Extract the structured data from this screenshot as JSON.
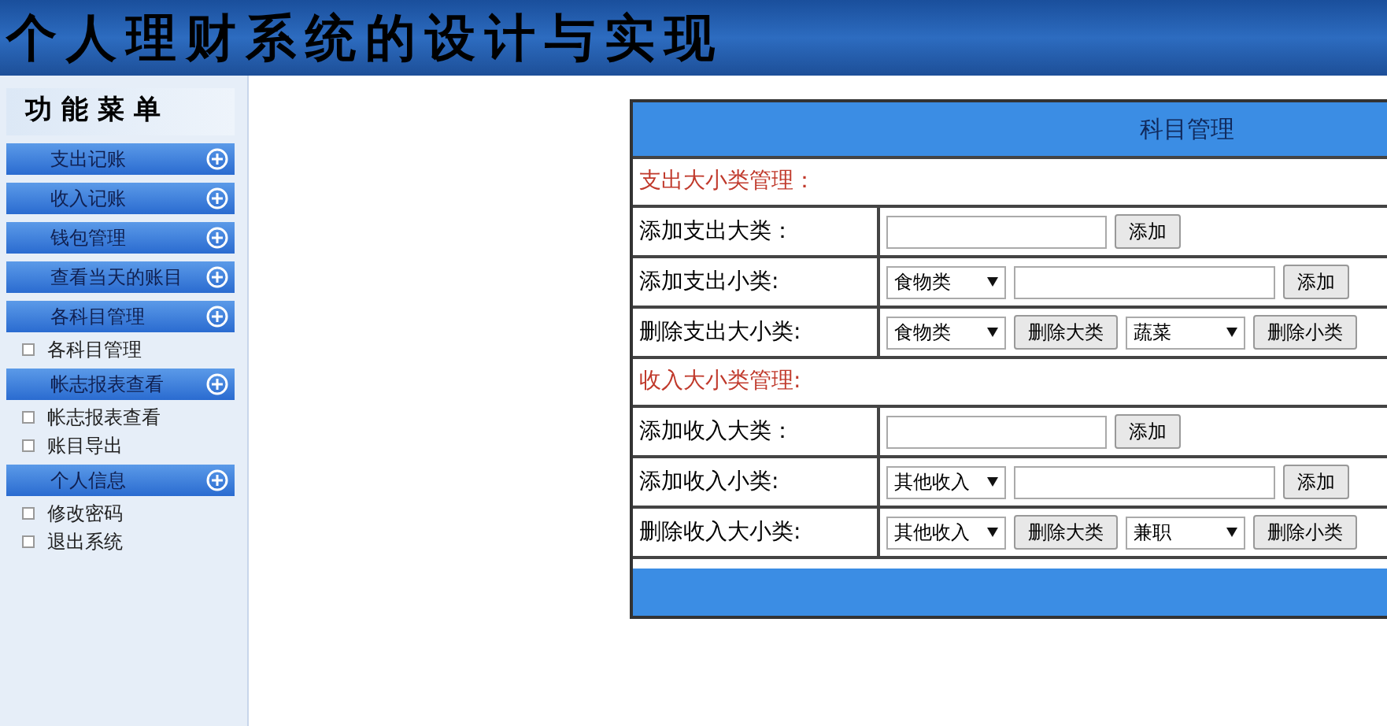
{
  "banner": {
    "title": "个人理财系统的设计与实现"
  },
  "sidebar": {
    "title": "功能菜单",
    "items": [
      {
        "kind": "group",
        "label": "支出记账"
      },
      {
        "kind": "group",
        "label": "收入记账"
      },
      {
        "kind": "group",
        "label": "钱包管理"
      },
      {
        "kind": "group",
        "label": "查看当天的账目"
      },
      {
        "kind": "group",
        "label": "各科目管理"
      },
      {
        "kind": "link",
        "label": "各科目管理"
      },
      {
        "kind": "group",
        "label": "帐志报表查看"
      },
      {
        "kind": "link",
        "label": "帐志报表查看"
      },
      {
        "kind": "link",
        "label": "账目导出"
      },
      {
        "kind": "group",
        "label": "个人信息"
      },
      {
        "kind": "link",
        "label": "修改密码"
      },
      {
        "kind": "link",
        "label": "退出系统"
      }
    ]
  },
  "panel": {
    "title": "科目管理",
    "rows": [
      {
        "kind": "section",
        "label": "支出大小类管理："
      },
      {
        "kind": "form",
        "label": "添加支出大类：",
        "controls": [
          {
            "kind": "input"
          },
          {
            "kind": "button",
            "label": "添加"
          }
        ]
      },
      {
        "kind": "form",
        "label": "添加支出小类:",
        "controls": [
          {
            "kind": "select",
            "value": "食物类"
          },
          {
            "kind": "input"
          },
          {
            "kind": "button",
            "label": "添加"
          }
        ]
      },
      {
        "kind": "form",
        "label": "删除支出大小类:",
        "controls": [
          {
            "kind": "select",
            "value": "食物类"
          },
          {
            "kind": "button",
            "label": "删除大类"
          },
          {
            "kind": "select",
            "value": "蔬菜"
          },
          {
            "kind": "button",
            "label": "删除小类"
          }
        ]
      },
      {
        "kind": "section",
        "label": "收入大小类管理:"
      },
      {
        "kind": "form",
        "label": "添加收入大类：",
        "controls": [
          {
            "kind": "input"
          },
          {
            "kind": "button",
            "label": "添加"
          }
        ]
      },
      {
        "kind": "form",
        "label": "添加收入小类:",
        "controls": [
          {
            "kind": "select",
            "value": "其他收入"
          },
          {
            "kind": "input"
          },
          {
            "kind": "button",
            "label": "添加"
          }
        ]
      },
      {
        "kind": "form",
        "label": "删除收入大小类:",
        "controls": [
          {
            "kind": "select",
            "value": "其他收入"
          },
          {
            "kind": "button",
            "label": "删除大类"
          },
          {
            "kind": "select",
            "value": "兼职"
          },
          {
            "kind": "button",
            "label": "删除小类"
          }
        ]
      }
    ]
  }
}
